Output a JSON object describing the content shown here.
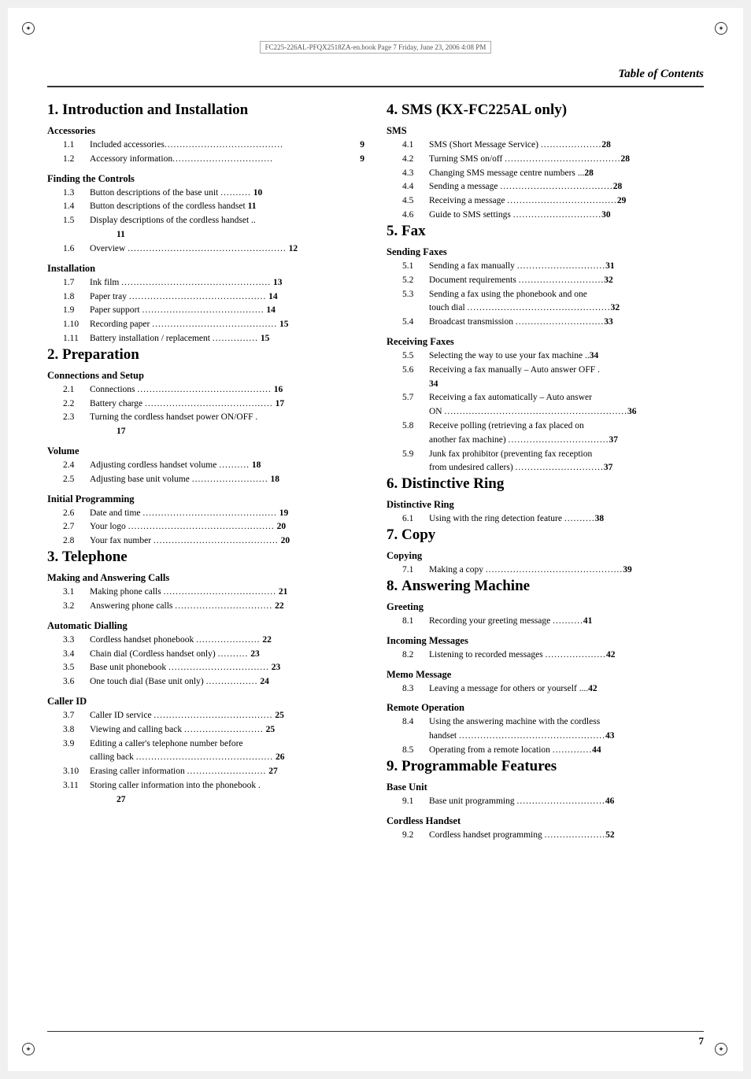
{
  "header": {
    "title": "Table of Contents",
    "page_number": "7"
  },
  "watermark": "FC225-226AL-PFQX2518ZA-en.book  Page 7  Friday, June 23, 2006  4:08 PM",
  "left_column": {
    "sections": [
      {
        "id": "s1",
        "number": "1.",
        "title": "Introduction and Installation",
        "subsections": [
          {
            "id": "ss1a",
            "name": "Accessories",
            "entries": [
              {
                "num": "1.1",
                "text": "Included accessories",
                "page": "9"
              },
              {
                "num": "1.2",
                "text": "Accessory information",
                "page": "9"
              }
            ]
          },
          {
            "id": "ss1b",
            "name": "Finding the Controls",
            "entries": [
              {
                "num": "1.3",
                "text": "Button descriptions of the base unit",
                "page": "10"
              },
              {
                "num": "1.4",
                "text": "Button descriptions of the cordless handset",
                "page": "11"
              },
              {
                "num": "1.5",
                "text": "Display descriptions of the cordless handset ..",
                "page": "11"
              },
              {
                "num": "1.6",
                "text": "Overview",
                "page": "12"
              }
            ]
          },
          {
            "id": "ss1c",
            "name": "Installation",
            "entries": [
              {
                "num": "1.7",
                "text": "Ink film",
                "page": "13"
              },
              {
                "num": "1.8",
                "text": "Paper tray",
                "page": "14"
              },
              {
                "num": "1.9",
                "text": "Paper support",
                "page": "14"
              },
              {
                "num": "1.10",
                "text": "Recording paper",
                "page": "15"
              },
              {
                "num": "1.11",
                "text": "Battery installation / replacement",
                "page": "15"
              }
            ]
          }
        ]
      },
      {
        "id": "s2",
        "number": "2.",
        "title": "Preparation",
        "subsections": [
          {
            "id": "ss2a",
            "name": "Connections and Setup",
            "entries": [
              {
                "num": "2.1",
                "text": "Connections",
                "page": "16"
              },
              {
                "num": "2.2",
                "text": "Battery charge",
                "page": "17"
              },
              {
                "num": "2.3",
                "text": "Turning the cordless handset power ON/OFF .",
                "page": "17"
              }
            ]
          },
          {
            "id": "ss2b",
            "name": "Volume",
            "entries": [
              {
                "num": "2.4",
                "text": "Adjusting cordless handset volume",
                "page": "18"
              },
              {
                "num": "2.5",
                "text": "Adjusting base unit volume",
                "page": "18"
              }
            ]
          },
          {
            "id": "ss2c",
            "name": "Initial Programming",
            "entries": [
              {
                "num": "2.6",
                "text": "Date and time",
                "page": "19"
              },
              {
                "num": "2.7",
                "text": "Your logo",
                "page": "20"
              },
              {
                "num": "2.8",
                "text": "Your fax number",
                "page": "20"
              }
            ]
          }
        ]
      },
      {
        "id": "s3",
        "number": "3.",
        "title": "Telephone",
        "subsections": [
          {
            "id": "ss3a",
            "name": "Making and Answering Calls",
            "entries": [
              {
                "num": "3.1",
                "text": "Making phone calls",
                "page": "21"
              },
              {
                "num": "3.2",
                "text": "Answering phone calls",
                "page": "22"
              }
            ]
          },
          {
            "id": "ss3b",
            "name": "Automatic Dialling",
            "entries": [
              {
                "num": "3.3",
                "text": "Cordless handset phonebook",
                "page": "22"
              },
              {
                "num": "3.4",
                "text": "Chain dial (Cordless handset only)",
                "page": "23"
              },
              {
                "num": "3.5",
                "text": "Base unit phonebook",
                "page": "23"
              },
              {
                "num": "3.6",
                "text": "One touch dial (Base unit only)",
                "page": "24"
              }
            ]
          },
          {
            "id": "ss3c",
            "name": "Caller ID",
            "entries": [
              {
                "num": "3.7",
                "text": "Caller ID service",
                "page": "25"
              },
              {
                "num": "3.8",
                "text": "Viewing and calling back",
                "page": "25"
              },
              {
                "num": "3.9",
                "text": "Editing a caller's telephone number before calling back",
                "page": "26"
              },
              {
                "num": "3.10",
                "text": "Erasing caller information",
                "page": "27"
              },
              {
                "num": "3.11",
                "text": "Storing caller information into the phonebook .",
                "page": "27"
              }
            ]
          }
        ]
      }
    ]
  },
  "right_column": {
    "sections": [
      {
        "id": "s4",
        "number": "4.",
        "title": "SMS (KX-FC225AL only)",
        "subsections": [
          {
            "id": "ss4a",
            "name": "SMS",
            "entries": [
              {
                "num": "4.1",
                "text": "SMS (Short Message Service)",
                "page": "28"
              },
              {
                "num": "4.2",
                "text": "Turning SMS on/off",
                "page": "28"
              },
              {
                "num": "4.3",
                "text": "Changing SMS message centre numbers ...",
                "page": "28"
              },
              {
                "num": "4.4",
                "text": "Sending a message",
                "page": "28"
              },
              {
                "num": "4.5",
                "text": "Receiving a message",
                "page": "29"
              },
              {
                "num": "4.6",
                "text": "Guide to SMS settings",
                "page": "30"
              }
            ]
          }
        ]
      },
      {
        "id": "s5",
        "number": "5.",
        "title": "Fax",
        "subsections": [
          {
            "id": "ss5a",
            "name": "Sending Faxes",
            "entries": [
              {
                "num": "5.1",
                "text": "Sending a fax manually",
                "page": "31"
              },
              {
                "num": "5.2",
                "text": "Document requirements",
                "page": "32"
              },
              {
                "num": "5.3",
                "text": "Sending a fax using the phonebook and one touch dial",
                "page": "32"
              },
              {
                "num": "5.4",
                "text": "Broadcast transmission",
                "page": "33"
              }
            ]
          },
          {
            "id": "ss5b",
            "name": "Receiving Faxes",
            "entries": [
              {
                "num": "5.5",
                "text": "Selecting the way to use your fax machine ..",
                "page": "34"
              },
              {
                "num": "5.6",
                "text": "Receiving a fax manually – Auto answer OFF . 34",
                "page": ""
              },
              {
                "num": "5.7",
                "text": "Receiving a fax automatically – Auto answer ON",
                "page": "36"
              },
              {
                "num": "5.8",
                "text": "Receive polling (retrieving a fax placed on another fax machine)",
                "page": "37"
              },
              {
                "num": "5.9",
                "text": "Junk fax prohibitor (preventing fax reception from undesired callers)",
                "page": "37"
              }
            ]
          }
        ]
      },
      {
        "id": "s6",
        "number": "6.",
        "title": "Distinctive Ring",
        "subsections": [
          {
            "id": "ss6a",
            "name": "Distinctive Ring",
            "entries": [
              {
                "num": "6.1",
                "text": "Using with the ring detection feature",
                "page": "38"
              }
            ]
          }
        ]
      },
      {
        "id": "s7",
        "number": "7.",
        "title": "Copy",
        "subsections": [
          {
            "id": "ss7a",
            "name": "Copying",
            "entries": [
              {
                "num": "7.1",
                "text": "Making a copy",
                "page": "39"
              }
            ]
          }
        ]
      },
      {
        "id": "s8",
        "number": "8.",
        "title": "Answering Machine",
        "subsections": [
          {
            "id": "ss8a",
            "name": "Greeting",
            "entries": [
              {
                "num": "8.1",
                "text": "Recording your greeting message",
                "page": "41"
              }
            ]
          },
          {
            "id": "ss8b",
            "name": "Incoming Messages",
            "entries": [
              {
                "num": "8.2",
                "text": "Listening to recorded messages",
                "page": "42"
              }
            ]
          },
          {
            "id": "ss8c",
            "name": "Memo Message",
            "entries": [
              {
                "num": "8.3",
                "text": "Leaving a message for others or yourself ....",
                "page": "42"
              }
            ]
          },
          {
            "id": "ss8d",
            "name": "Remote Operation",
            "entries": [
              {
                "num": "8.4",
                "text": "Using the answering machine with the cordless handset",
                "page": "43"
              },
              {
                "num": "8.5",
                "text": "Operating from a remote location",
                "page": "44"
              }
            ]
          }
        ]
      },
      {
        "id": "s9",
        "number": "9.",
        "title": "Programmable Features",
        "subsections": [
          {
            "id": "ss9a",
            "name": "Base Unit",
            "entries": [
              {
                "num": "9.1",
                "text": "Base unit programming",
                "page": "46"
              }
            ]
          },
          {
            "id": "ss9b",
            "name": "Cordless Handset",
            "entries": [
              {
                "num": "9.2",
                "text": "Cordless handset programming",
                "page": "52"
              }
            ]
          }
        ]
      }
    ]
  }
}
